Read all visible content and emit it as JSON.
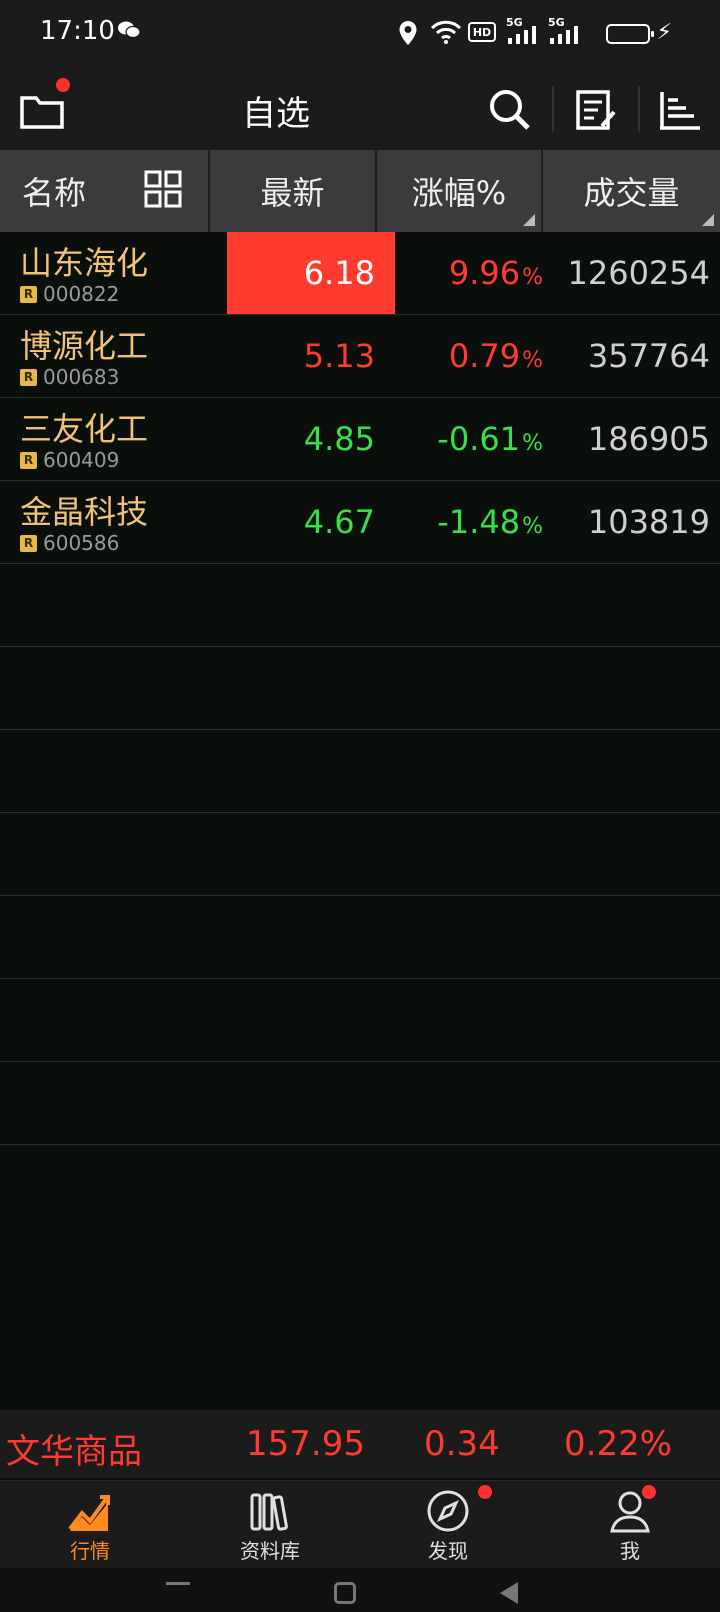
{
  "status_bar": {
    "time": "17:10",
    "hd": "HD",
    "net1": "5G",
    "net2": "5G"
  },
  "header": {
    "title": "自选"
  },
  "columns": {
    "name": "名称",
    "latest": "最新",
    "change": "涨幅%",
    "volume": "成交量"
  },
  "stocks": [
    {
      "name": "山东海化",
      "badge": "R",
      "code": "000822",
      "price": "6.18",
      "change": "9.96",
      "pct": "%",
      "volume": "1260254",
      "color": "#ff3b30",
      "highlight": true
    },
    {
      "name": "博源化工",
      "badge": "R",
      "code": "000683",
      "price": "5.13",
      "change": "0.79",
      "pct": "%",
      "volume": "357764",
      "color": "#ff3b30",
      "highlight": false
    },
    {
      "name": "三友化工",
      "badge": "R",
      "code": "600409",
      "price": "4.85",
      "change": "-0.61",
      "pct": "%",
      "volume": "186905",
      "color": "#35e048",
      "highlight": false
    },
    {
      "name": "金晶科技",
      "badge": "R",
      "code": "600586",
      "price": "4.67",
      "change": "-1.48",
      "pct": "%",
      "volume": "103819",
      "color": "#35e048",
      "highlight": false
    }
  ],
  "ticker": {
    "name": "文华商品",
    "value": "157.95",
    "change": "0.34",
    "pct": "0.22%"
  },
  "tabs": [
    {
      "label": "行情",
      "icon": "market-chart-icon",
      "active": true
    },
    {
      "label": "资料库",
      "icon": "library-books-icon",
      "active": false
    },
    {
      "label": "发现",
      "icon": "compass-icon",
      "active": false
    },
    {
      "label": "我",
      "icon": "person-icon",
      "active": false
    }
  ],
  "colors": {
    "up": "#ff3b30",
    "down": "#35e048",
    "stock_name": "#f0c27a",
    "active_tab": "#ff8a1f",
    "highlight_bg": "#ff3b30"
  }
}
